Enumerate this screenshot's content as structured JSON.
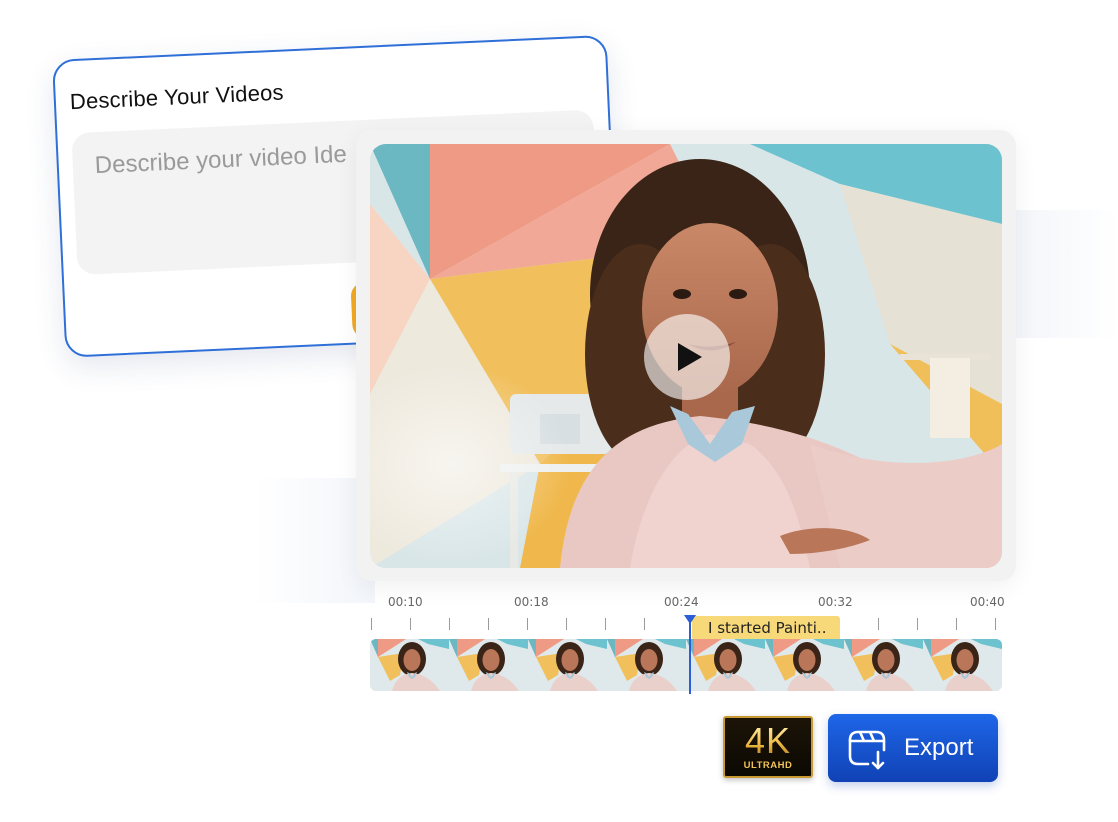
{
  "describe_card": {
    "title": "Describe Your Videos",
    "placeholder": "Describe your video Ide"
  },
  "video": {
    "play_icon": "play-icon"
  },
  "timeline": {
    "time_labels": [
      "00:10",
      "00:18",
      "00:24",
      "00:32",
      "00:40"
    ],
    "caption": "I started Painti..",
    "frame_count": 8
  },
  "badge": {
    "main": "4K",
    "sub": "ULTRAHD"
  },
  "export": {
    "label": "Export",
    "icon": "export-video-icon"
  },
  "colors": {
    "accent_blue": "#1e66e8",
    "card_border": "#2f6fd8",
    "caption_yellow": "#f8d97a",
    "generate_orange": "#f2a924",
    "badge_gold": "#f1bf47"
  }
}
